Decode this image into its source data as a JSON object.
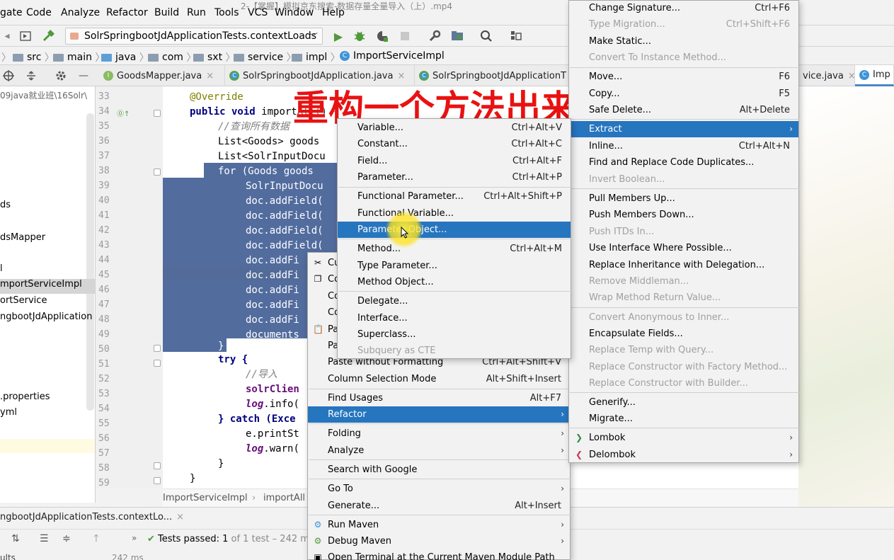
{
  "window": {
    "title": "2-【掌握】模拟京东搜索-数据存量全量导入（上）.mp4"
  },
  "menubar": [
    "gate",
    "Code",
    "Analyze",
    "Refactor",
    "Build",
    "Run",
    "Tools",
    "VCS",
    "Window",
    "Help"
  ],
  "toolbar": {
    "run_config": "SolrSpringbootJdApplicationTests.contextLoads"
  },
  "breadcrumb": [
    "src",
    "main",
    "java",
    "com",
    "sxt",
    "service",
    "impl",
    "ImportServiceImpl"
  ],
  "tabs": [
    {
      "label": "GoodsMapper.java",
      "kind": "interface"
    },
    {
      "label": "SolrSpringbootJdApplication.java",
      "kind": "class-green"
    },
    {
      "label": "SolrSpringbootJdApplicationT",
      "kind": "class-green"
    },
    {
      "label": "vice.java",
      "kind": "interface"
    },
    {
      "label": "Imp",
      "kind": "class",
      "active": true
    }
  ],
  "project": {
    "path": "09java就业班\\16Solr\\",
    "items": [
      {
        "label": "ds",
        "selected": false
      },
      {
        "label": "dsMapper",
        "selected": false
      },
      {
        "label": "l",
        "selected": false
      },
      {
        "label": "mportServiceImpl",
        "selected": true
      },
      {
        "label": "ortService",
        "selected": false
      },
      {
        "label": "ngbootJdApplication",
        "selected": false
      },
      {
        "label": ".properties",
        "selected": false
      },
      {
        "label": "yml",
        "selected": false
      }
    ]
  },
  "editor": {
    "line_numbers": [
      "33",
      "34",
      "35",
      "36",
      "37",
      "38",
      "39",
      "40",
      "41",
      "42",
      "43",
      "44",
      "45",
      "46",
      "47",
      "48",
      "49",
      "50",
      "51",
      "52",
      "53",
      "54",
      "55",
      "56",
      "57",
      "58",
      "59"
    ],
    "lines": {
      "l33": "@Override",
      "l34a": "public void ",
      "l34b": "importAll() {",
      "l35": "//查询所有数据",
      "l36": "List<Goods> goods",
      "l37": "List<SolrInputDocu",
      "l38": "for (Goods goods ",
      "l39": "SolrInputDocu",
      "l40": "doc.addField(",
      "l41": "doc.addField(",
      "l42": "doc.addField(",
      "l43": "doc.addField(",
      "l44": "doc.addFi",
      "l45": "doc.addFi",
      "l46": "doc.addFi",
      "l47": "doc.addFi",
      "l48": "doc.addFi",
      "l49": "documents",
      "l50": "}",
      "l51": "try {",
      "l52": "//导入",
      "l53": "solrClien",
      "l54a": "log",
      "l54b": ".info(",
      "l55a": "} catch (Exce",
      "l56": "e.printSt",
      "l57a": "log",
      "l57b": ".warn(",
      "l58": "}",
      "l59": "}"
    },
    "crumbs": [
      "ImportServiceImpl",
      "importAll"
    ]
  },
  "overlay_banner": "重构一个方法出来",
  "run_panel": {
    "tab_label": "ngbootJdApplicationTests.contextLo...",
    "tests_passed": "Tests passed: 1",
    "tests_detail": "of 1 test – 242 m",
    "results_label": "ults",
    "ms_label": "242 ms"
  },
  "context_menu": {
    "items": [
      {
        "label": "Cu",
        "shortcut": "",
        "icon": "scissors-icon"
      },
      {
        "label": "Co",
        "shortcut": "",
        "icon": "copy-icon"
      },
      {
        "label": "Co",
        "shortcut": ""
      },
      {
        "label": "Co",
        "shortcut": ""
      },
      {
        "label": "Pa",
        "shortcut": "",
        "icon": "clipboard-icon"
      },
      {
        "label": "Pa",
        "shortcut": ""
      },
      {
        "label": "Paste without Formatting",
        "shortcut": "Ctrl+Alt+Shift+V"
      },
      {
        "label": "Column Selection Mode",
        "shortcut": "Alt+Shift+Insert"
      },
      {
        "label": "Find Usages",
        "shortcut": "Alt+F7"
      },
      {
        "label": "Refactor",
        "shortcut": "",
        "submenu": true,
        "highlighted": true
      },
      {
        "label": "Folding",
        "shortcut": "",
        "submenu": true
      },
      {
        "label": "Analyze",
        "shortcut": "",
        "submenu": true
      },
      {
        "label": "Search with Google",
        "shortcut": ""
      },
      {
        "label": "Go To",
        "shortcut": "",
        "submenu": true
      },
      {
        "label": "Generate...",
        "shortcut": "Alt+Insert"
      },
      {
        "label": "Run Maven",
        "shortcut": "",
        "submenu": true,
        "icon": "gear-icon"
      },
      {
        "label": "Debug Maven",
        "shortcut": "",
        "submenu": true,
        "icon": "gear-icon"
      },
      {
        "label": "Open Terminal at the Current Maven Module Path",
        "shortcut": ""
      }
    ]
  },
  "refactor_menu": {
    "items": [
      {
        "label": "Change Signature...",
        "shortcut": "Ctrl+F6"
      },
      {
        "label": "Type Migration...",
        "shortcut": "Ctrl+Shift+F6",
        "disabled": true
      },
      {
        "label": "Make Static...",
        "shortcut": ""
      },
      {
        "label": "Convert To Instance Method...",
        "shortcut": "",
        "disabled": true
      },
      {
        "label": "Move...",
        "shortcut": "F6"
      },
      {
        "label": "Copy...",
        "shortcut": "F5"
      },
      {
        "label": "Safe Delete...",
        "shortcut": "Alt+Delete"
      },
      {
        "label": "Extract",
        "shortcut": "",
        "submenu": true,
        "highlighted": true
      },
      {
        "label": "Inline...",
        "shortcut": "Ctrl+Alt+N"
      },
      {
        "label": "Find and Replace Code Duplicates...",
        "shortcut": ""
      },
      {
        "label": "Invert Boolean...",
        "shortcut": "",
        "disabled": true
      },
      {
        "label": "Pull Members Up...",
        "shortcut": ""
      },
      {
        "label": "Push Members Down...",
        "shortcut": ""
      },
      {
        "label": "Push ITDs In...",
        "shortcut": "",
        "disabled": true
      },
      {
        "label": "Use Interface Where Possible...",
        "shortcut": ""
      },
      {
        "label": "Replace Inheritance with Delegation...",
        "shortcut": ""
      },
      {
        "label": "Remove Middleman...",
        "shortcut": "",
        "disabled": true
      },
      {
        "label": "Wrap Method Return Value...",
        "shortcut": "",
        "disabled": true
      },
      {
        "label": "Convert Anonymous to Inner...",
        "shortcut": "",
        "disabled": true
      },
      {
        "label": "Encapsulate Fields...",
        "shortcut": ""
      },
      {
        "label": "Replace Temp with Query...",
        "shortcut": "",
        "disabled": true
      },
      {
        "label": "Replace Constructor with Factory Method...",
        "shortcut": "",
        "disabled": true
      },
      {
        "label": "Replace Constructor with Builder...",
        "shortcut": "",
        "disabled": true
      },
      {
        "label": "Generify...",
        "shortcut": ""
      },
      {
        "label": "Migrate...",
        "shortcut": ""
      },
      {
        "label": "Lombok",
        "shortcut": "",
        "submenu": true,
        "icon": "lombok-icon"
      },
      {
        "label": "Delombok",
        "shortcut": "",
        "submenu": true,
        "icon": "delombok-icon"
      }
    ]
  },
  "extract_menu": {
    "items": [
      {
        "label": "Variable...",
        "shortcut": "Ctrl+Alt+V"
      },
      {
        "label": "Constant...",
        "shortcut": "Ctrl+Alt+C"
      },
      {
        "label": "Field...",
        "shortcut": "Ctrl+Alt+F"
      },
      {
        "label": "Parameter...",
        "shortcut": "Ctrl+Alt+P"
      },
      {
        "label": "Functional Parameter...",
        "shortcut": "Ctrl+Alt+Shift+P"
      },
      {
        "label": "Functional Variable...",
        "shortcut": ""
      },
      {
        "label": "Parameter Object...",
        "shortcut": "",
        "highlighted": true
      },
      {
        "label": "Method...",
        "shortcut": "Ctrl+Alt+M"
      },
      {
        "label": "Type Parameter...",
        "shortcut": ""
      },
      {
        "label": "Method Object...",
        "shortcut": ""
      },
      {
        "label": "Delegate...",
        "shortcut": ""
      },
      {
        "label": "Interface...",
        "shortcut": ""
      },
      {
        "label": "Superclass...",
        "shortcut": ""
      },
      {
        "label": "Subquery as CTE",
        "shortcut": "",
        "disabled": true
      }
    ]
  },
  "colors": {
    "highlight": "#2675bf",
    "selection": "#214283",
    "banner": "#e81212"
  }
}
